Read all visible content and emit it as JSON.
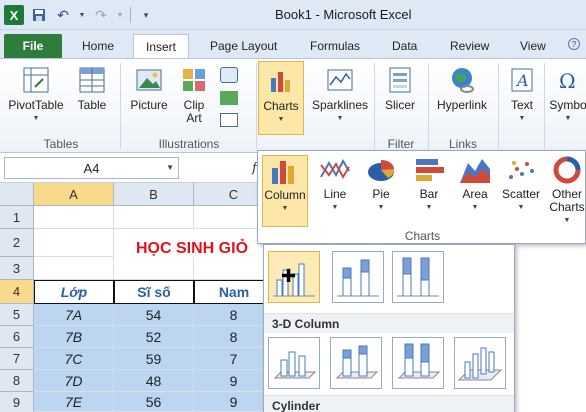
{
  "window": {
    "title": "Book1 - Microsoft Excel"
  },
  "tabs": [
    "File",
    "Home",
    "Insert",
    "Page Layout",
    "Formulas",
    "Data",
    "Review",
    "View"
  ],
  "ribbon": {
    "tables": {
      "pivot": "PivotTable",
      "table": "Table",
      "group": "Tables"
    },
    "illustrations": {
      "picture": "Picture",
      "clip1": "Clip",
      "clip2": "Art",
      "group": "Illustrations"
    },
    "charts": {
      "label": "Charts"
    },
    "sparklines": {
      "label": "Sparklines"
    },
    "filter": {
      "slicer": "Slicer",
      "group": "Filter"
    },
    "links": {
      "hyperlink": "Hyperlink",
      "group": "Links"
    },
    "text": {
      "label": "Text"
    },
    "symbols": {
      "label": "Symbo"
    }
  },
  "namebox": "A4",
  "fx": "f",
  "columns": [
    "A",
    "B",
    "C"
  ],
  "rows": [
    "1",
    "2",
    "3",
    "4",
    "5",
    "6",
    "7",
    "8",
    "9"
  ],
  "sheet": {
    "title": "HỌC SINH GIỎ",
    "header": [
      "Lớp",
      "Sĩ số",
      "Nam"
    ],
    "data": [
      [
        "7A",
        "54",
        "8"
      ],
      [
        "7B",
        "52",
        "8"
      ],
      [
        "7C",
        "59",
        "7"
      ],
      [
        "7D",
        "48",
        "9"
      ],
      [
        "7E",
        "56",
        "9"
      ]
    ]
  },
  "charts_panel": {
    "buttons": [
      {
        "label1": "Column",
        "label2": ""
      },
      {
        "label1": "Line",
        "label2": ""
      },
      {
        "label1": "Pie",
        "label2": ""
      },
      {
        "label1": "Bar",
        "label2": ""
      },
      {
        "label1": "Area",
        "label2": ""
      },
      {
        "label1": "Scatter",
        "label2": ""
      },
      {
        "label1": "Other",
        "label2": "Charts"
      }
    ],
    "group": "Charts"
  },
  "gallery": {
    "sections": [
      "3-D Column",
      "Cylinder"
    ]
  },
  "colors": {
    "accent": "#2f7d3b",
    "selection": "#bcd5f0",
    "title_red": "#e0141a",
    "header_blue": "#2a5fa8"
  }
}
